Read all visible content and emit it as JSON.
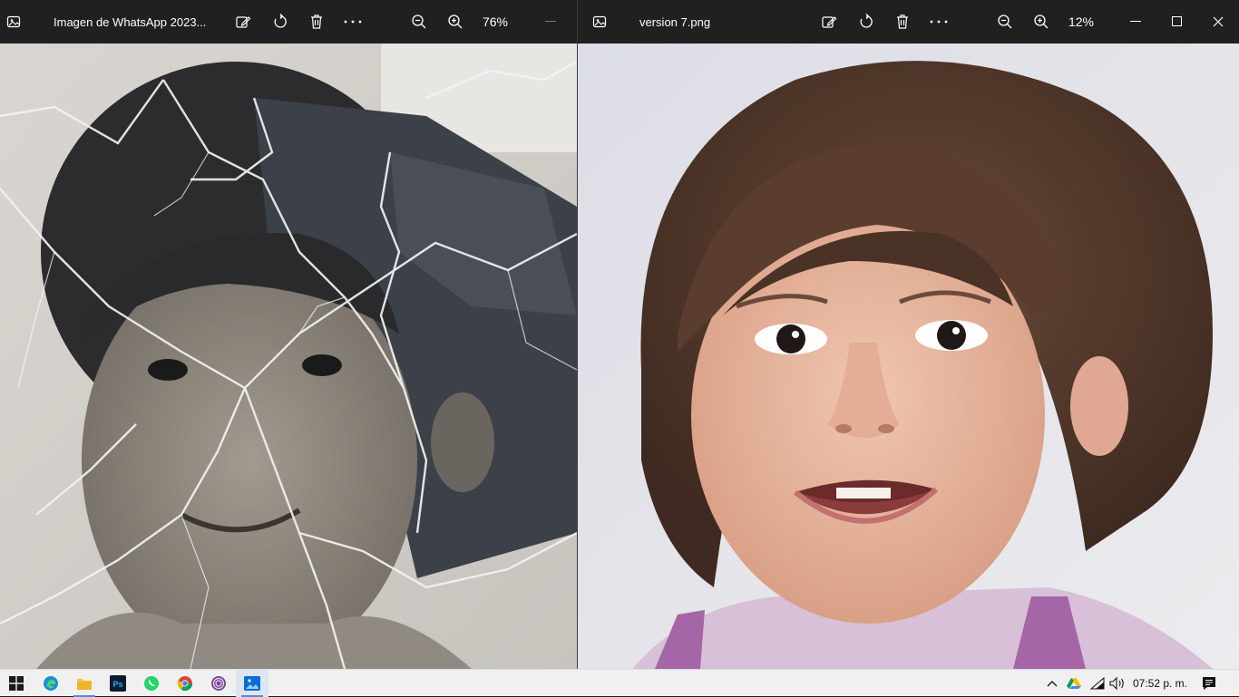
{
  "left_window": {
    "title": "Imagen de WhatsApp 2023...",
    "zoom": "76%",
    "icons": [
      "photos-app-icon",
      "edit-image-icon",
      "rotate-icon",
      "delete-icon",
      "more-icon",
      "zoom-out-icon",
      "zoom-in-icon"
    ],
    "image_description": "black-and-white cracked photo"
  },
  "right_window": {
    "title": "version 7.png",
    "zoom": "12%",
    "icons": [
      "photos-app-icon",
      "edit-image-icon",
      "rotate-icon",
      "delete-icon",
      "more-icon",
      "zoom-out-icon",
      "zoom-in-icon",
      "minimize-icon",
      "maximize-icon",
      "close-icon"
    ],
    "image_description": "restored color photo"
  },
  "taskbar": {
    "apps": [
      "windows-start",
      "edge",
      "file-explorer",
      "photoshop",
      "whatsapp",
      "chrome",
      "tor-browser",
      "photos"
    ],
    "active_app": "photos",
    "clock": "07:52 p. m."
  },
  "colors": {
    "titlebar": "#202020",
    "taskbar": "#f0f0f0",
    "accent": "#4a8fd8"
  }
}
